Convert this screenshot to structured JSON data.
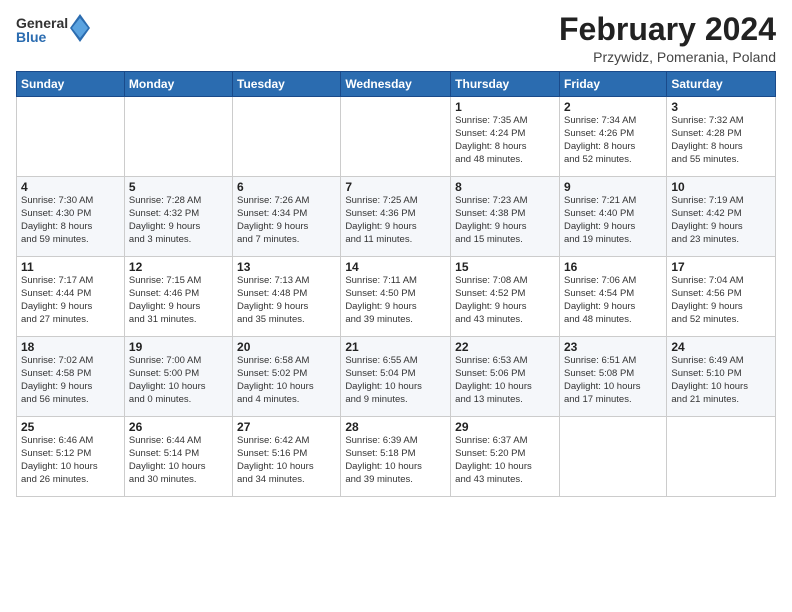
{
  "logo": {
    "general": "General",
    "blue": "Blue"
  },
  "title": "February 2024",
  "location": "Przywidz, Pomerania, Poland",
  "days_of_week": [
    "Sunday",
    "Monday",
    "Tuesday",
    "Wednesday",
    "Thursday",
    "Friday",
    "Saturday"
  ],
  "weeks": [
    [
      {
        "day": "",
        "info": ""
      },
      {
        "day": "",
        "info": ""
      },
      {
        "day": "",
        "info": ""
      },
      {
        "day": "",
        "info": ""
      },
      {
        "day": "1",
        "info": "Sunrise: 7:35 AM\nSunset: 4:24 PM\nDaylight: 8 hours\nand 48 minutes."
      },
      {
        "day": "2",
        "info": "Sunrise: 7:34 AM\nSunset: 4:26 PM\nDaylight: 8 hours\nand 52 minutes."
      },
      {
        "day": "3",
        "info": "Sunrise: 7:32 AM\nSunset: 4:28 PM\nDaylight: 8 hours\nand 55 minutes."
      }
    ],
    [
      {
        "day": "4",
        "info": "Sunrise: 7:30 AM\nSunset: 4:30 PM\nDaylight: 8 hours\nand 59 minutes."
      },
      {
        "day": "5",
        "info": "Sunrise: 7:28 AM\nSunset: 4:32 PM\nDaylight: 9 hours\nand 3 minutes."
      },
      {
        "day": "6",
        "info": "Sunrise: 7:26 AM\nSunset: 4:34 PM\nDaylight: 9 hours\nand 7 minutes."
      },
      {
        "day": "7",
        "info": "Sunrise: 7:25 AM\nSunset: 4:36 PM\nDaylight: 9 hours\nand 11 minutes."
      },
      {
        "day": "8",
        "info": "Sunrise: 7:23 AM\nSunset: 4:38 PM\nDaylight: 9 hours\nand 15 minutes."
      },
      {
        "day": "9",
        "info": "Sunrise: 7:21 AM\nSunset: 4:40 PM\nDaylight: 9 hours\nand 19 minutes."
      },
      {
        "day": "10",
        "info": "Sunrise: 7:19 AM\nSunset: 4:42 PM\nDaylight: 9 hours\nand 23 minutes."
      }
    ],
    [
      {
        "day": "11",
        "info": "Sunrise: 7:17 AM\nSunset: 4:44 PM\nDaylight: 9 hours\nand 27 minutes."
      },
      {
        "day": "12",
        "info": "Sunrise: 7:15 AM\nSunset: 4:46 PM\nDaylight: 9 hours\nand 31 minutes."
      },
      {
        "day": "13",
        "info": "Sunrise: 7:13 AM\nSunset: 4:48 PM\nDaylight: 9 hours\nand 35 minutes."
      },
      {
        "day": "14",
        "info": "Sunrise: 7:11 AM\nSunset: 4:50 PM\nDaylight: 9 hours\nand 39 minutes."
      },
      {
        "day": "15",
        "info": "Sunrise: 7:08 AM\nSunset: 4:52 PM\nDaylight: 9 hours\nand 43 minutes."
      },
      {
        "day": "16",
        "info": "Sunrise: 7:06 AM\nSunset: 4:54 PM\nDaylight: 9 hours\nand 48 minutes."
      },
      {
        "day": "17",
        "info": "Sunrise: 7:04 AM\nSunset: 4:56 PM\nDaylight: 9 hours\nand 52 minutes."
      }
    ],
    [
      {
        "day": "18",
        "info": "Sunrise: 7:02 AM\nSunset: 4:58 PM\nDaylight: 9 hours\nand 56 minutes."
      },
      {
        "day": "19",
        "info": "Sunrise: 7:00 AM\nSunset: 5:00 PM\nDaylight: 10 hours\nand 0 minutes."
      },
      {
        "day": "20",
        "info": "Sunrise: 6:58 AM\nSunset: 5:02 PM\nDaylight: 10 hours\nand 4 minutes."
      },
      {
        "day": "21",
        "info": "Sunrise: 6:55 AM\nSunset: 5:04 PM\nDaylight: 10 hours\nand 9 minutes."
      },
      {
        "day": "22",
        "info": "Sunrise: 6:53 AM\nSunset: 5:06 PM\nDaylight: 10 hours\nand 13 minutes."
      },
      {
        "day": "23",
        "info": "Sunrise: 6:51 AM\nSunset: 5:08 PM\nDaylight: 10 hours\nand 17 minutes."
      },
      {
        "day": "24",
        "info": "Sunrise: 6:49 AM\nSunset: 5:10 PM\nDaylight: 10 hours\nand 21 minutes."
      }
    ],
    [
      {
        "day": "25",
        "info": "Sunrise: 6:46 AM\nSunset: 5:12 PM\nDaylight: 10 hours\nand 26 minutes."
      },
      {
        "day": "26",
        "info": "Sunrise: 6:44 AM\nSunset: 5:14 PM\nDaylight: 10 hours\nand 30 minutes."
      },
      {
        "day": "27",
        "info": "Sunrise: 6:42 AM\nSunset: 5:16 PM\nDaylight: 10 hours\nand 34 minutes."
      },
      {
        "day": "28",
        "info": "Sunrise: 6:39 AM\nSunset: 5:18 PM\nDaylight: 10 hours\nand 39 minutes."
      },
      {
        "day": "29",
        "info": "Sunrise: 6:37 AM\nSunset: 5:20 PM\nDaylight: 10 hours\nand 43 minutes."
      },
      {
        "day": "",
        "info": ""
      },
      {
        "day": "",
        "info": ""
      }
    ]
  ]
}
